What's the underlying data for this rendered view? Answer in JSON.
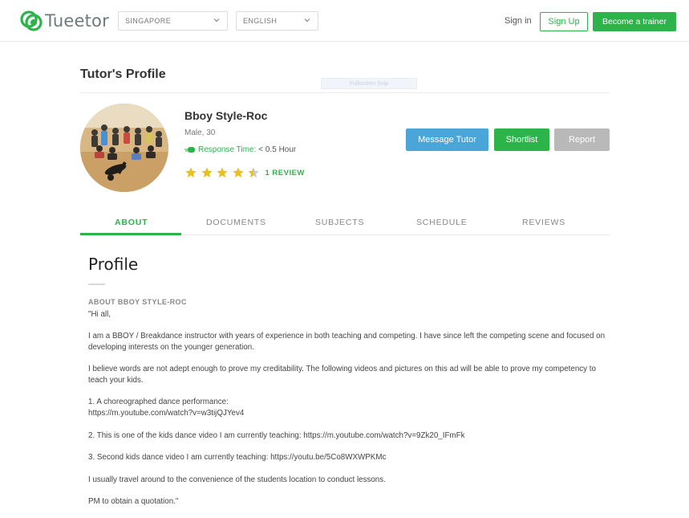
{
  "header": {
    "logo_text": "Tueetor",
    "country_select": "SINGAPORE",
    "language_select": "ENGLISH",
    "signin_label": "Sign in",
    "signup_label": "Sign Up",
    "trainer_label": "Become a trainer",
    "brand_color": "#2cb34a"
  },
  "page": {
    "title": "Tutor's Profile",
    "ghost_box_text": "Fullscreen Snip"
  },
  "tutor": {
    "name": "Bboy Style-Roc",
    "meta": "Male, 30",
    "response_label": "Response Time:",
    "response_value": "< 0.5 Hour",
    "rating": 4.5,
    "rating_max": 5,
    "review_label": "1 REVIEW"
  },
  "actions": {
    "message": "Message Tutor",
    "shortlist": "Shortlist",
    "report": "Report"
  },
  "tabs": [
    {
      "label": "ABOUT",
      "active": true
    },
    {
      "label": "DOCUMENTS"
    },
    {
      "label": "SUBJECTS"
    },
    {
      "label": "SCHEDULE"
    },
    {
      "label": "REVIEWS"
    }
  ],
  "about": {
    "section_title": "Profile",
    "label": "ABOUT BBOY STYLE-ROC",
    "paragraphs": [
      "\"Hi all,",
      "I am a BBOY / Breakdance instructor with years of experience in both teaching and competing. I have since left the competing scene and focused on developing interests on the younger generation.",
      "I believe words are not adept enough to prove my creditability. The following videos and pictures on this ad will be able to prove my competency to teach your kids.",
      "1. A choreographed dance performance:",
      "https://m.youtube.com/watch?v=w3tijQJYev4",
      "2. This is one of the kids dance video I am currently teaching: https://m.youtube.com/watch?v=9Zk20_IFmFk",
      "3. Second kids dance video I am currently teaching: https://youtu.be/5Co8WXWPKMc",
      "I usually travel around to the convenience of the students location to conduct lessons.",
      "PM to obtain a quotation.\""
    ]
  }
}
